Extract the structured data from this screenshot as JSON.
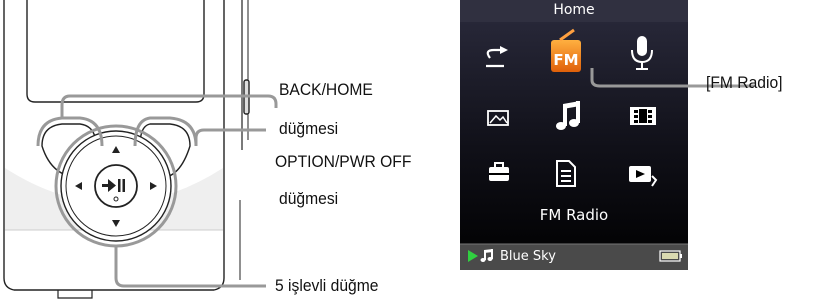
{
  "labels": {
    "back_home": "BACK/HOME",
    "back_home_sub": "düğmesi",
    "option": "OPTION/PWR OFF",
    "option_sub": "düğmesi",
    "five_way": "5 işlevli düğme",
    "fm_radio": "[FM Radio]"
  },
  "screen": {
    "title": "Home",
    "selected_caption": "FM Radio",
    "now_playing": "Blue Sky",
    "fm_icon_text": "FM",
    "menu_icons": [
      "shuffle-icon",
      "fm-radio-icon",
      "microphone-icon",
      "photo-icon",
      "music-note-icon",
      "film-icon",
      "toolbox-icon",
      "document-icon",
      "playlist-icon"
    ]
  },
  "colors": {
    "screen_bg": "#000000",
    "screen_top": "#2a2a3a",
    "status_bar": "#4a4a4a",
    "fm_orange": "#f07a10",
    "play_green": "#30d040"
  }
}
